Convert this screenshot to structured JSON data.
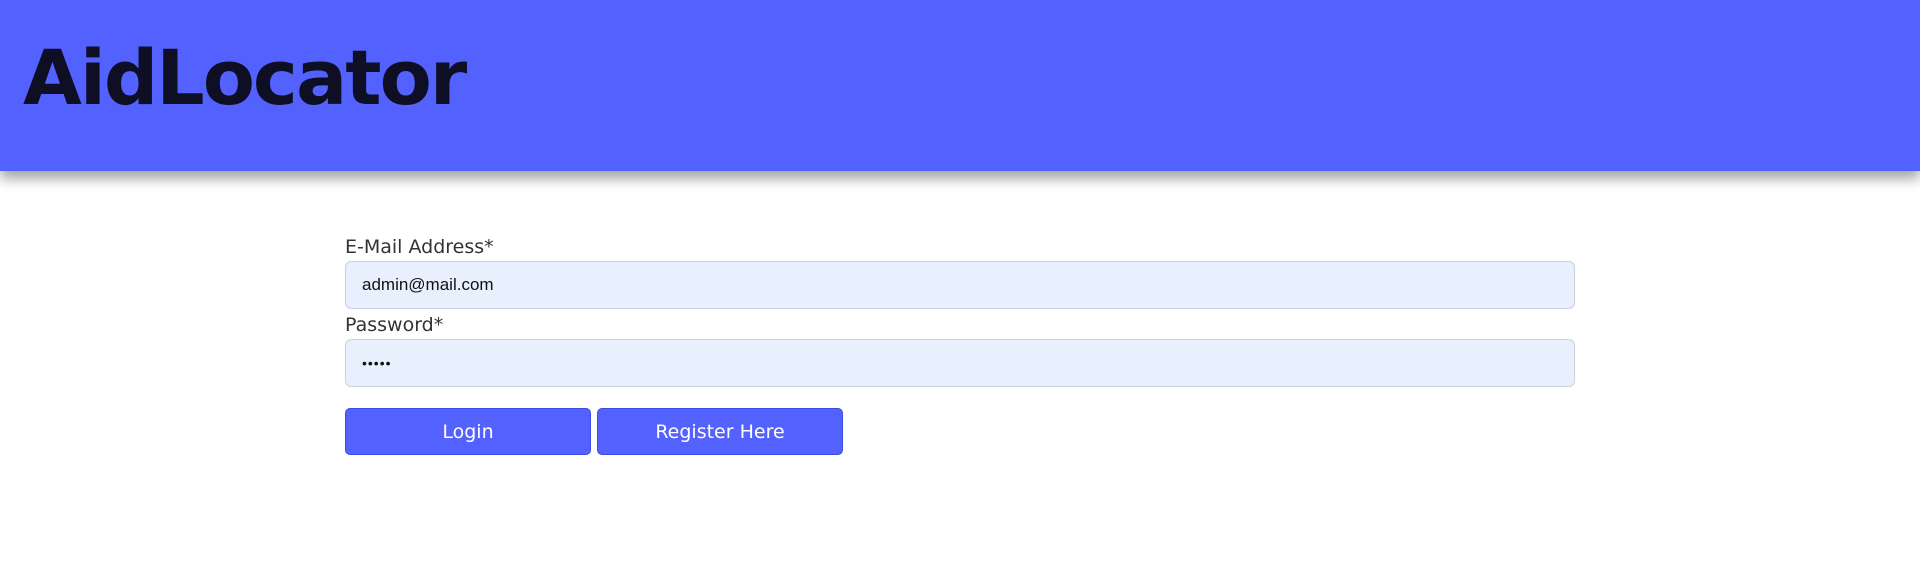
{
  "header": {
    "brand": "AidLocator"
  },
  "login_form": {
    "email_label": "E-Mail Address*",
    "email_value": "admin@mail.com",
    "password_label": "Password*",
    "password_value": "•••••",
    "login_button": "Login",
    "register_button": "Register Here"
  },
  "colors": {
    "brand": "#5361ff",
    "input_background": "#e8f0fe"
  }
}
